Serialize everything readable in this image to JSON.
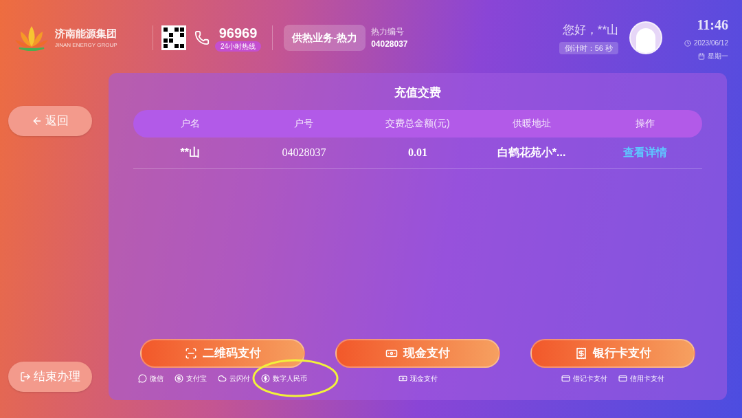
{
  "header": {
    "logo": {
      "name": "济南能源集团",
      "name_en": "JINAN ENERGY GROUP"
    },
    "hotline": {
      "number": "96969",
      "badge": "24小时热线"
    },
    "service_button": "供热业务-热力",
    "account": {
      "label": "热力编号",
      "number": "04028037"
    },
    "user": {
      "greeting": "您好，**山",
      "countdown": "倒计时：56 秒"
    },
    "clock": {
      "time": "11:46",
      "date": "2023/06/12",
      "weekday": "星期一"
    }
  },
  "nav": [
    {
      "kind": "back",
      "label": "返回"
    },
    {
      "kind": "exit",
      "label": "结束办理"
    }
  ],
  "panel": {
    "title": "充值交费",
    "columns": [
      "户名",
      "户号",
      "交费总金额(元)",
      "供暖地址",
      "操作"
    ],
    "rows": [
      {
        "name": "**山",
        "number": "04028037",
        "amount": "0.01",
        "address": "白鹤花苑小*...",
        "action": "查看详情"
      }
    ],
    "payments": [
      {
        "kind": "qr",
        "label": "二维码支付",
        "options": [
          {
            "kind": "wechat",
            "label": "微信"
          },
          {
            "kind": "alipay",
            "label": "支付宝"
          },
          {
            "kind": "unionpay",
            "label": "云闪付"
          },
          {
            "kind": "ecny",
            "label": "数字人民币"
          }
        ]
      },
      {
        "kind": "cash",
        "label": "现金支付",
        "options": [
          {
            "kind": "cash",
            "label": "现金支付"
          }
        ]
      },
      {
        "kind": "card",
        "label": "银行卡支付",
        "options": [
          {
            "kind": "card",
            "label": "借记卡支付"
          },
          {
            "kind": "card",
            "label": "信用卡支付"
          }
        ]
      }
    ]
  }
}
